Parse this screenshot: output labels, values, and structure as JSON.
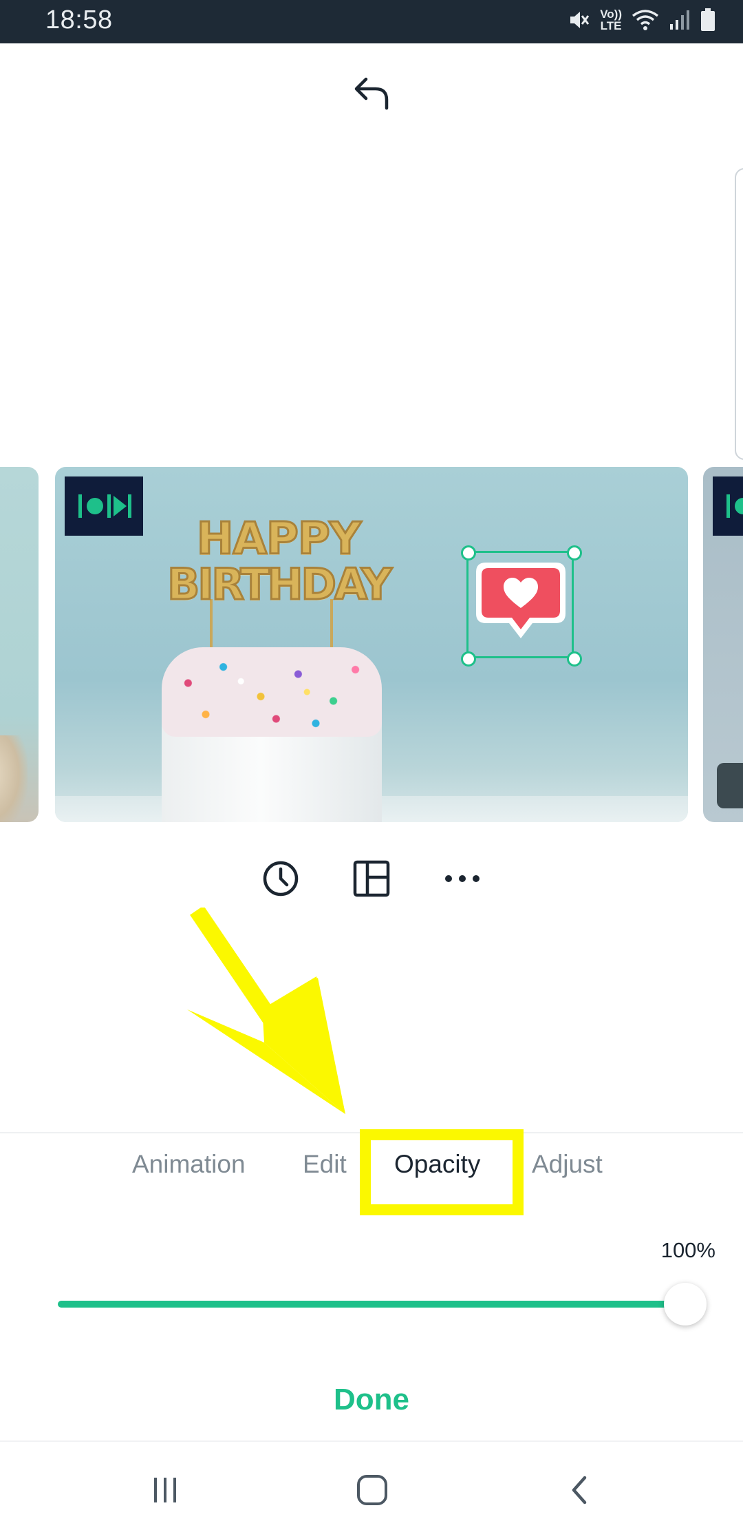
{
  "status_bar": {
    "time": "18:58",
    "volte_top": "Vo))",
    "volte_bottom": "LTE",
    "icons": [
      "mute-icon",
      "volte-icon",
      "wifi-icon",
      "signal-icon",
      "battery-icon"
    ]
  },
  "toolbar": {
    "undo_icon": "undo-icon"
  },
  "slide": {
    "cake_text_line1": "HAPPY",
    "cake_text_line2": "BIRTHDAY",
    "badge_icon": "media-badge-icon",
    "sticker_icon": "heart-comment-sticker"
  },
  "clip_tools": {
    "items": [
      "clock-icon",
      "layout-icon",
      "more-icon"
    ]
  },
  "panel": {
    "tabs": [
      {
        "label": "Animation",
        "active": false
      },
      {
        "label": "Edit",
        "active": false
      },
      {
        "label": "Opacity",
        "active": true
      },
      {
        "label": "Adjust",
        "active": false
      }
    ],
    "opacity_value": "100%",
    "opacity_level": 1.0,
    "done_label": "Done"
  },
  "colors": {
    "accent": "#1ec08a",
    "status_bar": "#1e2a36",
    "annotation_yellow": "#fbf800",
    "sticker_red": "#ef4f5f"
  },
  "nav_bar": {
    "items": [
      "recent-apps-icon",
      "home-icon",
      "back-icon"
    ]
  }
}
